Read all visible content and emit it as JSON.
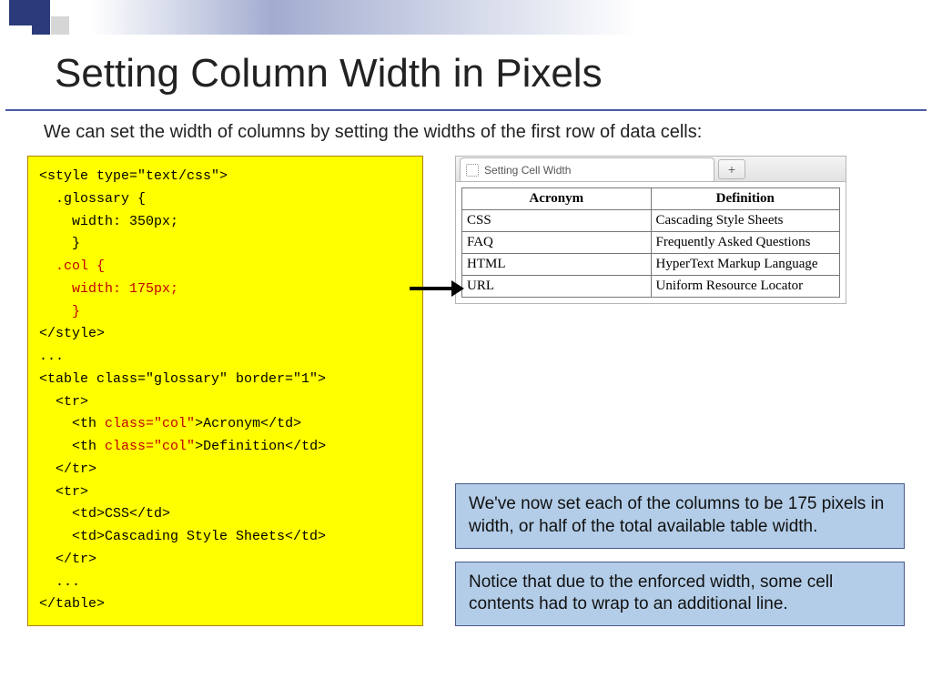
{
  "title": "Setting Column Width in Pixels",
  "intro": "We can set the width of columns by setting the widths of the first row of data cells:",
  "code": {
    "l1": "<style type=\"text/css\">",
    "l2": ".glossary {",
    "l3": "width: 350px;",
    "l4": "}",
    "l5": ".col {",
    "l6": "width: 175px;",
    "l7": "}",
    "l8": "</style>",
    "l9": "...",
    "l10": "<table class=\"glossary\" border=\"1\">",
    "l11": "<tr>",
    "l12a": "<th ",
    "l12b": "class=\"col\"",
    "l12c": ">Acronym</td>",
    "l13a": "<th ",
    "l13b": "class=\"col\"",
    "l13c": ">Definition</td>",
    "l14": "</tr>",
    "l15": "<tr>",
    "l16": "<td>CSS</td>",
    "l17": "<td>Cascading Style Sheets</td>",
    "l18": "</tr>",
    "l19": "...",
    "l20": "</table>"
  },
  "browser": {
    "tab_title": "Setting Cell Width",
    "newtab_symbol": "+",
    "table": {
      "headers": [
        "Acronym",
        "Definition"
      ],
      "rows": [
        [
          "CSS",
          "Cascading Style Sheets"
        ],
        [
          "FAQ",
          "Frequently Asked Questions"
        ],
        [
          "HTML",
          "HyperText Markup Language"
        ],
        [
          "URL",
          "Uniform Resource Locator"
        ]
      ]
    }
  },
  "callout1": "We've now set each of the columns to be 175 pixels in width, or half of the total available table width.",
  "callout2": "Notice that due to the enforced width, some cell contents had to wrap to an additional line."
}
